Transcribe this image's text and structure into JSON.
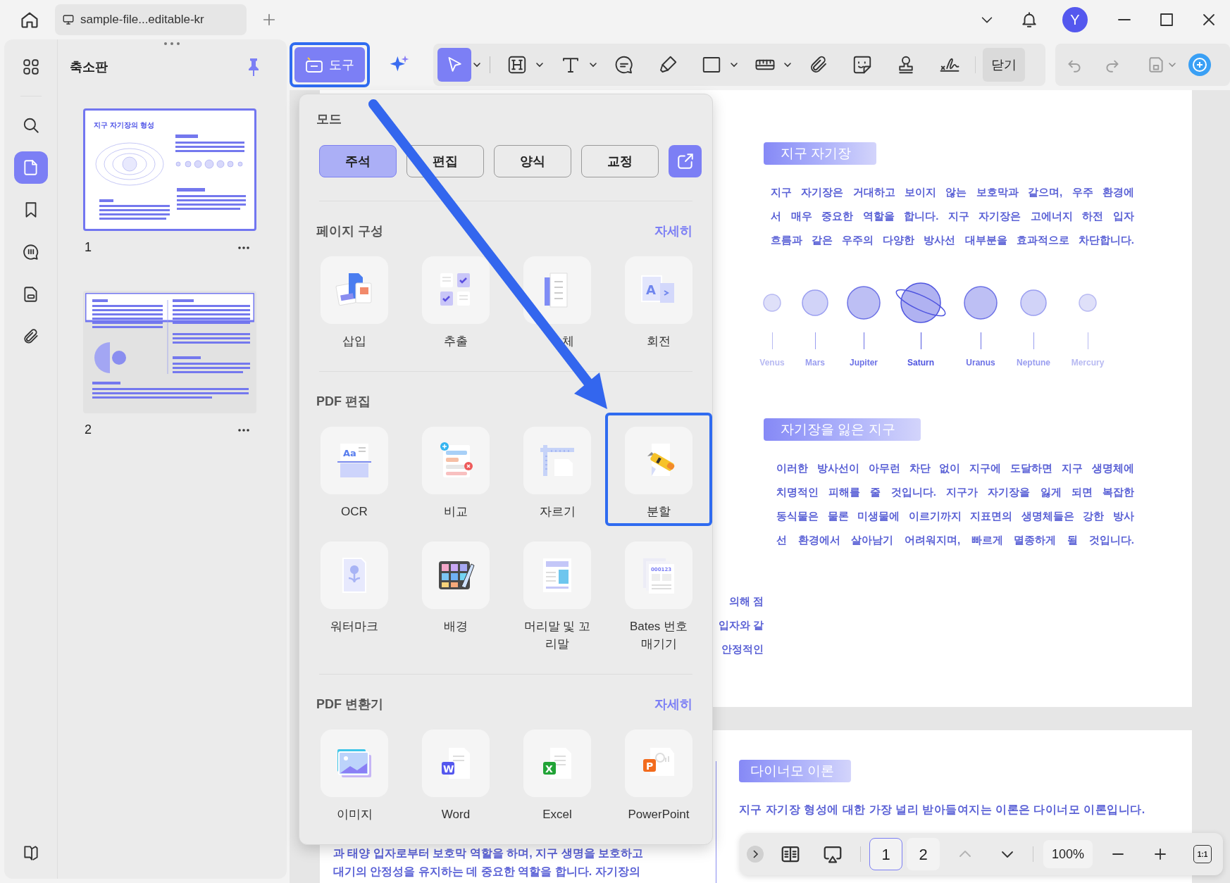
{
  "titlebar": {
    "tab": {
      "title": "sample-file...editable-kr"
    },
    "avatar": "Y"
  },
  "sidebar": {
    "items": [
      {
        "kind": "grid",
        "selected": false
      },
      {
        "kind": "search",
        "selected": false
      },
      {
        "kind": "pages",
        "selected": true
      },
      {
        "kind": "bookmark",
        "selected": false
      },
      {
        "kind": "comment",
        "selected": false
      },
      {
        "kind": "form",
        "selected": false
      },
      {
        "kind": "attachment",
        "selected": false
      }
    ],
    "bottom_items": [
      {
        "kind": "book",
        "selected": false
      }
    ]
  },
  "thumbnails": {
    "title": "축소판",
    "pages": [
      {
        "label": "1",
        "heading": "지구 자기장의 형성",
        "selected": true
      },
      {
        "label": "2",
        "selected": false
      }
    ]
  },
  "toolbar": {
    "tools_button": {
      "label": "도구",
      "highlighted": true
    },
    "tools": [
      {
        "kind": "select",
        "selected": true,
        "has_menu": true
      },
      {
        "kind": "heading",
        "selected": false,
        "has_menu": true
      },
      {
        "kind": "text",
        "selected": false,
        "has_menu": true
      },
      {
        "kind": "comment",
        "selected": false,
        "has_menu": false
      },
      {
        "kind": "highlighter",
        "selected": false,
        "has_menu": false
      },
      {
        "kind": "rectangle",
        "selected": false,
        "has_menu": true
      },
      {
        "kind": "measure",
        "selected": false,
        "has_menu": true
      },
      {
        "kind": "attachment",
        "selected": false,
        "has_menu": false
      },
      {
        "kind": "sticker",
        "selected": false,
        "has_menu": false
      },
      {
        "kind": "stamp",
        "selected": false,
        "has_menu": false
      },
      {
        "kind": "signature",
        "selected": false,
        "has_menu": false
      }
    ],
    "close_label": "닫기"
  },
  "menu": {
    "mode_title": "모드",
    "modes": [
      {
        "label": "주석",
        "selected": true
      },
      {
        "label": "편집",
        "selected": false
      },
      {
        "label": "양식",
        "selected": false
      },
      {
        "label": "교정",
        "selected": false
      }
    ],
    "sections": [
      {
        "title": "페이지 구성",
        "more": "자세히",
        "items": [
          {
            "kind": "insert",
            "label": "삽입",
            "highlighted": false
          },
          {
            "kind": "extract",
            "label": "추출",
            "highlighted": false
          },
          {
            "kind": "replace",
            "label": "체",
            "highlighted": false
          },
          {
            "kind": "rotate",
            "label": "회전",
            "badge": "A",
            "highlighted": false
          }
        ]
      },
      {
        "title": "PDF 편집",
        "items": [
          {
            "kind": "ocr",
            "label": "OCR",
            "badge": "Aa",
            "highlighted": false
          },
          {
            "kind": "compare",
            "label": "비교",
            "highlighted": false
          },
          {
            "kind": "crop",
            "label": "자르기",
            "highlighted": false
          },
          {
            "kind": "split",
            "label": "분할",
            "highlighted": true
          },
          {
            "kind": "watermark",
            "label": "워터마크",
            "highlighted": false
          },
          {
            "kind": "background",
            "label": "배경",
            "highlighted": false
          },
          {
            "kind": "header_footer",
            "label": "머리말 및 꼬리말",
            "highlighted": false
          },
          {
            "kind": "bates",
            "label": "Bates 번호 매기기",
            "badge": "000123",
            "highlighted": false
          }
        ]
      },
      {
        "title": "PDF 변환기",
        "more": "자세히",
        "items": [
          {
            "kind": "image",
            "label": "이미지",
            "highlighted": false
          },
          {
            "kind": "word",
            "label": "Word",
            "badge": "W",
            "highlighted": false
          },
          {
            "kind": "excel",
            "label": "Excel",
            "badge": "X",
            "highlighted": false
          },
          {
            "kind": "powerpoint",
            "label": "PowerPoint",
            "badge": "P",
            "highlighted": false
          }
        ]
      }
    ]
  },
  "document": {
    "page1": {
      "sections": [
        {
          "heading": "지구 자기장",
          "lines": [
            "지구 자기장은 거대하고 보이지 않는 보호막과 같으며, 우주 환경에",
            "서 매우 중요한 역할을 합니다. 지구 자기장은 고에너지 하전 입자",
            "흐름과 같은 우주의 다양한 방사선 대부분을 효과적으로 차단합니다."
          ]
        },
        {
          "heading": "자기장을 잃은 지구",
          "lines": [
            "이러한 방사선이 아무런 차단 없이 지구에 도달하면 지구 생명체에",
            "치명적인 피해를 줄 것입니다. 지구가 자기장을 잃게 되면 복잡한",
            "동식물은 물론 미생물에 이르기까지 지표면의 생명체들은 강한 방사",
            "선 환경에서 살아남기 어려워지며, 빠르게 멸종하게 될 것입니다."
          ]
        }
      ],
      "planets": [
        {
          "name": "Venus",
          "color": "#b8baf2"
        },
        {
          "name": "Mars",
          "color": "#9a9ef0"
        },
        {
          "name": "Jupiter",
          "color": "#6d72e6"
        },
        {
          "name": "Saturn",
          "color": "#4f55e0"
        },
        {
          "name": "Uranus",
          "color": "#6d72e6"
        },
        {
          "name": "Neptune",
          "color": "#9a9ef0"
        },
        {
          "name": "Mercury",
          "color": "#b8baf2"
        }
      ],
      "left_fragments": [
        "의해 점",
        "입자와 같",
        "안정적인"
      ]
    },
    "page2": {
      "heading": "다이너모 이론",
      "lines": [
        "지구 자기장 형성에 대한 가장 널리 받아들여지는 이론은 다이너모 이론입니다."
      ],
      "left_lines": [
        "과 태양 입자로부터 보호막 역할을 하며, 지구 생명을 보호하고",
        "대기의 안정성을 유지하는 데 중요한 역할을 합니다. 자기장의"
      ]
    }
  },
  "page_nav": {
    "pages": [
      {
        "label": "1",
        "selected": true
      },
      {
        "label": "2",
        "selected": false
      }
    ],
    "zoom": "100%",
    "fit": "1:1"
  }
}
